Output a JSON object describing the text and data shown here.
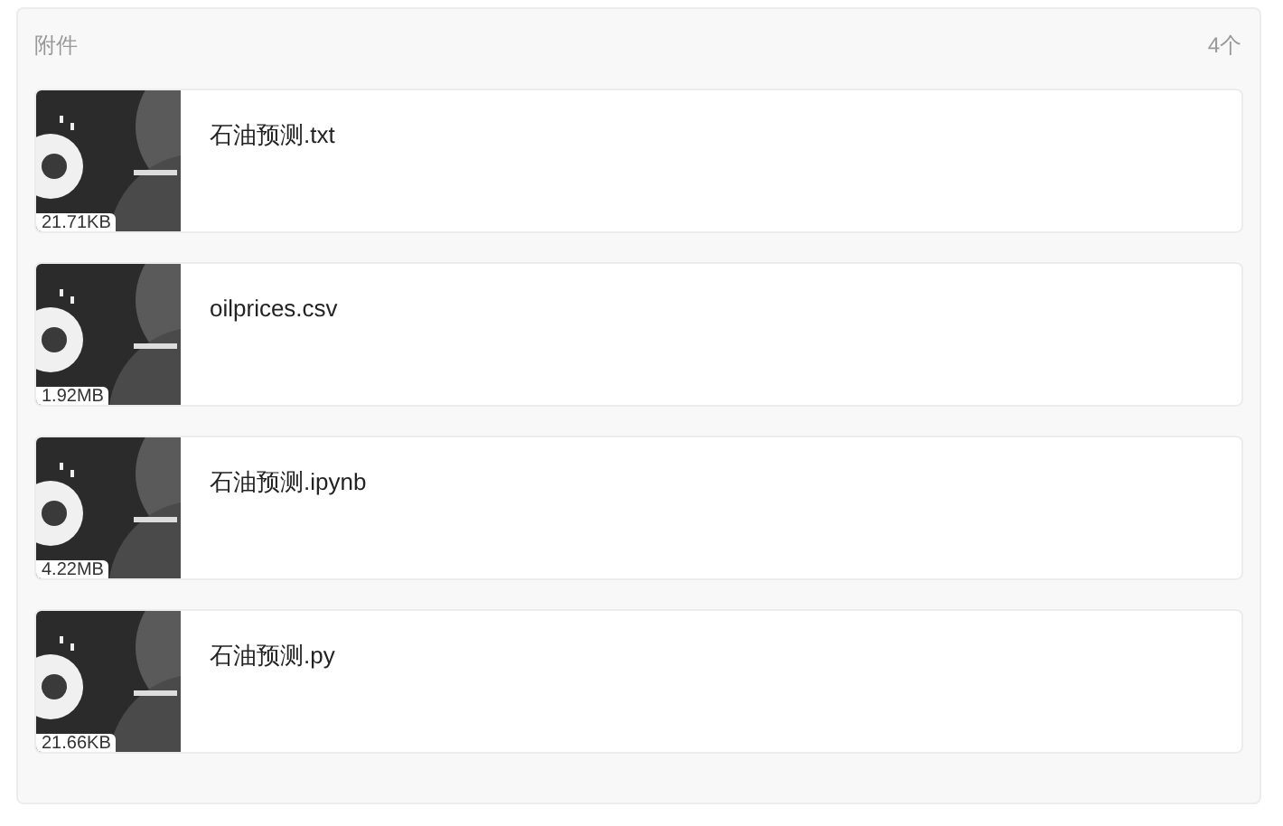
{
  "header": {
    "title": "附件",
    "count": "4个"
  },
  "files": [
    {
      "name": "石油预测.txt",
      "size": "21.71KB"
    },
    {
      "name": "oilprices.csv",
      "size": "1.92MB"
    },
    {
      "name": "石油预测.ipynb",
      "size": "4.22MB"
    },
    {
      "name": "石油预测.py",
      "size": "21.66KB"
    }
  ]
}
